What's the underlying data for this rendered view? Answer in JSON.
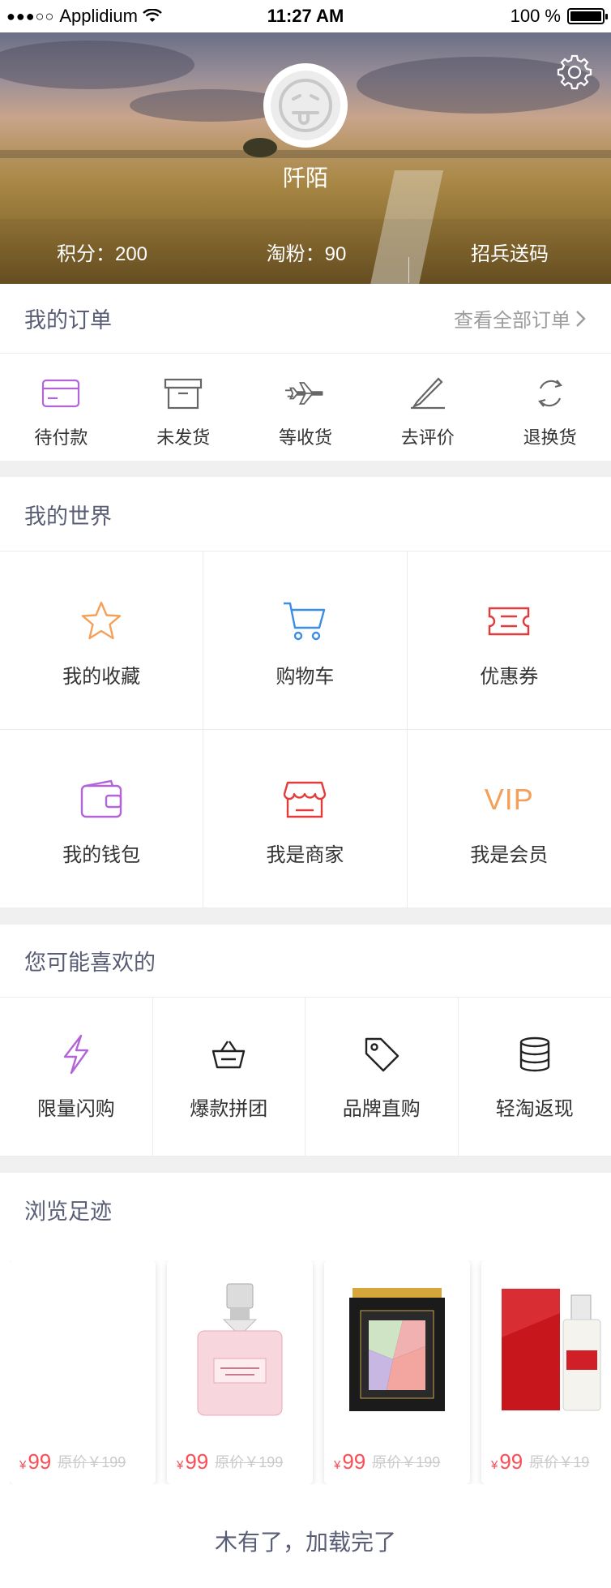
{
  "status_bar": {
    "carrier": "Applidium",
    "time": "11:27 AM",
    "battery": "100 %"
  },
  "profile": {
    "username": "阡陌",
    "points_label": "积分：200",
    "fans_label": "淘粉：90",
    "recruit_label": "招兵送码"
  },
  "orders": {
    "title": "我的订单",
    "view_all": "查看全部订单",
    "items": [
      {
        "label": "待付款",
        "icon": "card-icon"
      },
      {
        "label": "未发货",
        "icon": "box-icon"
      },
      {
        "label": "等收货",
        "icon": "plane-icon"
      },
      {
        "label": "去评价",
        "icon": "pen-icon"
      },
      {
        "label": "退换货",
        "icon": "exchange-icon"
      }
    ]
  },
  "world": {
    "title": "我的世界",
    "items": [
      {
        "label": "我的收藏",
        "icon": "star-icon"
      },
      {
        "label": "购物车",
        "icon": "cart-icon"
      },
      {
        "label": "优惠券",
        "icon": "ticket-icon"
      },
      {
        "label": "我的钱包",
        "icon": "wallet-icon"
      },
      {
        "label": "我是商家",
        "icon": "shop-icon"
      },
      {
        "label": "我是会员",
        "icon": "vip-icon",
        "glyph": "VIP"
      }
    ]
  },
  "likes": {
    "title": "您可能喜欢的",
    "items": [
      {
        "label": "限量闪购",
        "icon": "lightning-icon"
      },
      {
        "label": "爆款拼团",
        "icon": "basket-icon"
      },
      {
        "label": "品牌直购",
        "icon": "tag-icon"
      },
      {
        "label": "轻淘返现",
        "icon": "database-icon"
      }
    ]
  },
  "trail": {
    "title": "浏览足迹",
    "products": [
      {
        "currency": "¥",
        "price": "99",
        "original": "原价￥199",
        "image": "blank"
      },
      {
        "currency": "¥",
        "price": "99",
        "original": "原价￥199",
        "image": "perfume"
      },
      {
        "currency": "¥",
        "price": "99",
        "original": "原价￥199",
        "image": "palette"
      },
      {
        "currency": "¥",
        "price": "99",
        "original": "原价￥19",
        "image": "skincare"
      }
    ]
  },
  "footer_text": "木有了，加载完了",
  "colors": {
    "title": "#595d75",
    "muted": "#9c9c9c",
    "price": "#fd4c54",
    "original": "#cacaca",
    "divider": "#ececec",
    "gap": "#f0f0f0",
    "text": "#333333"
  }
}
